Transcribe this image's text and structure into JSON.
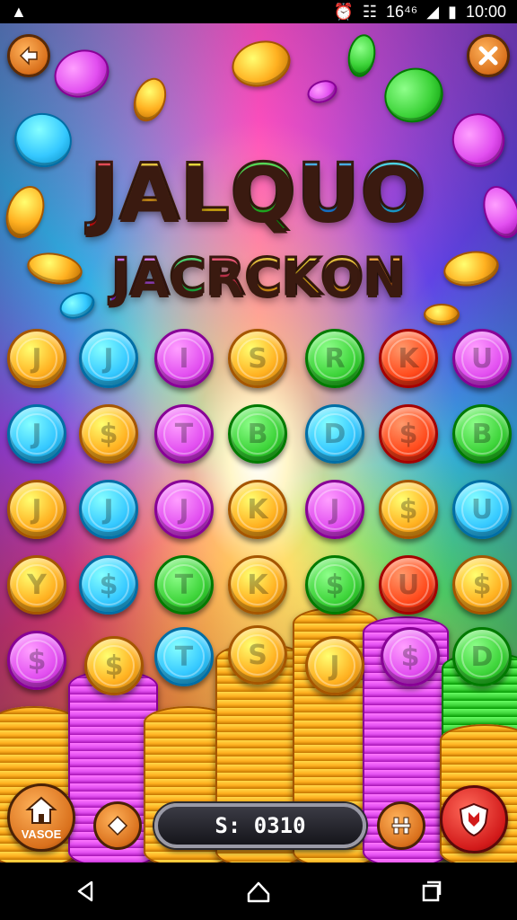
{
  "status_bar": {
    "signal_text": "16⁴⁶",
    "time": "10:00"
  },
  "title": {
    "line1": [
      "J",
      "A",
      "L",
      "Q",
      "U",
      "O"
    ],
    "line1_colors": [
      "#ff2e3a",
      "#ffb321",
      "#ffd21c",
      "#3ad83a",
      "#2a9bff",
      "#2fc7ff"
    ],
    "line2": [
      "J",
      "A",
      "C",
      "R",
      "C",
      "K",
      "O",
      "N"
    ],
    "line2_colors": [
      "#b54bff",
      "#c55bff",
      "#2fd05a",
      "#ff3b5c",
      "#ffb321",
      "#ffc21c",
      "#ffb321",
      "#ff8a21"
    ]
  },
  "grid": {
    "rows": [
      [
        {
          "l": "J",
          "c": "#ffb020"
        },
        {
          "l": "J",
          "c": "#35c8ff"
        },
        {
          "l": "I",
          "c": "#e24ff0"
        },
        {
          "l": "S",
          "c": "#ffb020"
        },
        {
          "l": "R",
          "c": "#3ed43a"
        },
        {
          "l": "K",
          "c": "#ff4a1c"
        },
        {
          "l": "U",
          "c": "#e24ff0"
        }
      ],
      [
        {
          "l": "J",
          "c": "#35c8ff"
        },
        {
          "l": "$",
          "c": "#ffb020"
        },
        {
          "l": "T",
          "c": "#e24ff0"
        },
        {
          "l": "B",
          "c": "#3ed43a"
        },
        {
          "l": "D",
          "c": "#35c8ff"
        },
        {
          "l": "$",
          "c": "#ff4a1c"
        },
        {
          "l": "B",
          "c": "#3ed43a"
        }
      ],
      [
        {
          "l": "J",
          "c": "#ffb020"
        },
        {
          "l": "J",
          "c": "#35c8ff"
        },
        {
          "l": "J",
          "c": "#e24ff0"
        },
        {
          "l": "K",
          "c": "#ffb020"
        },
        {
          "l": "J",
          "c": "#e24ff0"
        },
        {
          "l": "$",
          "c": "#ffb020"
        },
        {
          "l": "U",
          "c": "#35c8ff"
        }
      ],
      [
        {
          "l": "Y",
          "c": "#ffb020"
        },
        {
          "l": "$",
          "c": "#35c8ff"
        },
        {
          "l": "T",
          "c": "#3ed43a"
        },
        {
          "l": "K",
          "c": "#ffb020"
        },
        {
          "l": "$",
          "c": "#3ed43a"
        },
        {
          "l": "U",
          "c": "#ff4a1c"
        },
        {
          "l": "$",
          "c": "#ffb020"
        }
      ]
    ],
    "extra": [
      {
        "l": "$",
        "c": "#e24ff0"
      },
      {
        "l": "$",
        "c": "#ffb020"
      },
      {
        "l": "T",
        "c": "#35c8ff"
      },
      {
        "l": "S",
        "c": "#ffb020"
      },
      {
        "l": "J",
        "c": "#ffb020"
      },
      {
        "l": "$",
        "c": "#e24ff0"
      },
      {
        "l": "D",
        "c": "#3ed43a"
      }
    ]
  },
  "bottom_bar": {
    "save_label": "VASOE",
    "score": "S: 0310"
  },
  "colors": {
    "gold": "#ffb020",
    "blue": "#35c8ff",
    "magenta": "#e24ff0",
    "green": "#3ed43a",
    "red": "#ff4a1c",
    "button_orange": "#d9701c",
    "button_red": "#d21a1a"
  },
  "icons": {
    "back": "arrow-left-icon",
    "close": "close-icon",
    "save": "house-icon",
    "diamond": "diamond-icon",
    "pause": "pause-icon",
    "shield": "shield-icon",
    "nav_back": "triangle-back-icon",
    "nav_home": "home-icon",
    "nav_recents": "recents-icon"
  }
}
